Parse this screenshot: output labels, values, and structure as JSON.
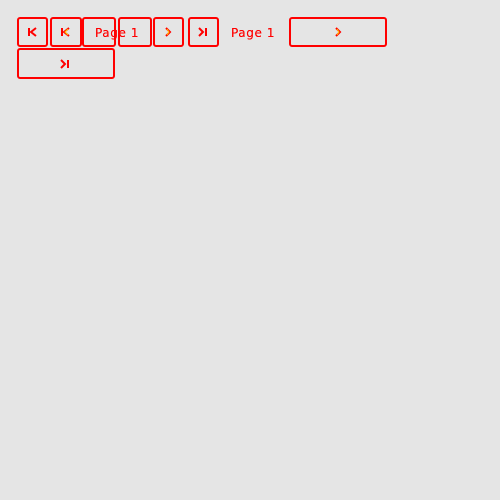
{
  "pager": {
    "first_icon": "⏮",
    "prev_icon": "⏴",
    "page_label_1": "Page 1",
    "next_icon": "›",
    "last_icon": "›|",
    "page_label_2": "Page 1",
    "next_icon_2": "›",
    "last_icon_2": "›|"
  },
  "colors": {
    "outline": "#ff0000",
    "background": "#e5e5e5"
  }
}
